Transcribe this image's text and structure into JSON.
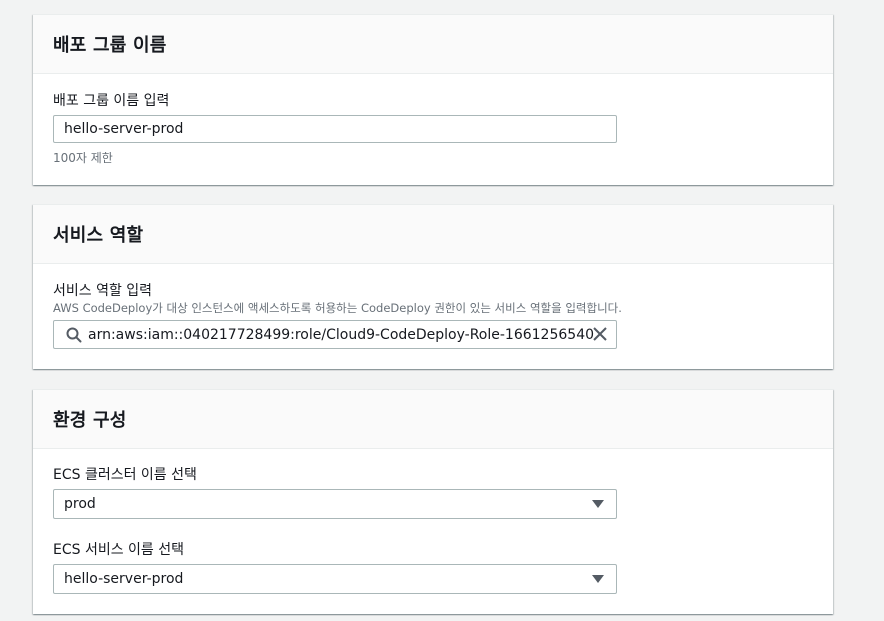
{
  "deployment_group": {
    "title": "배포 그룹 이름",
    "field_label": "배포 그룹 이름 입력",
    "value": "hello-server-prod",
    "constraint": "100자 제한"
  },
  "service_role": {
    "title": "서비스 역할",
    "field_label": "서비스 역할 입력",
    "description": "AWS CodeDeploy가 대상 인스턴스에 액세스하도록 허용하는 CodeDeploy 권한이 있는 서비스 역할을 입력합니다.",
    "value": "arn:aws:iam::040217728499:role/Cloud9-CodeDeploy-Role-1661256540"
  },
  "environment": {
    "title": "환경 구성",
    "cluster_label": "ECS 클러스터 이름 선택",
    "cluster_value": "prod",
    "service_label": "ECS 서비스 이름 선택",
    "service_value": "hello-server-prod"
  },
  "icons": {
    "search": "search-icon",
    "clear": "close-icon",
    "dropdown": "caret-down-icon"
  },
  "colors": {
    "background": "#f2f3f3",
    "panel_header": "#fafafa",
    "border": "#aab7b8",
    "muted_text": "#687078"
  }
}
